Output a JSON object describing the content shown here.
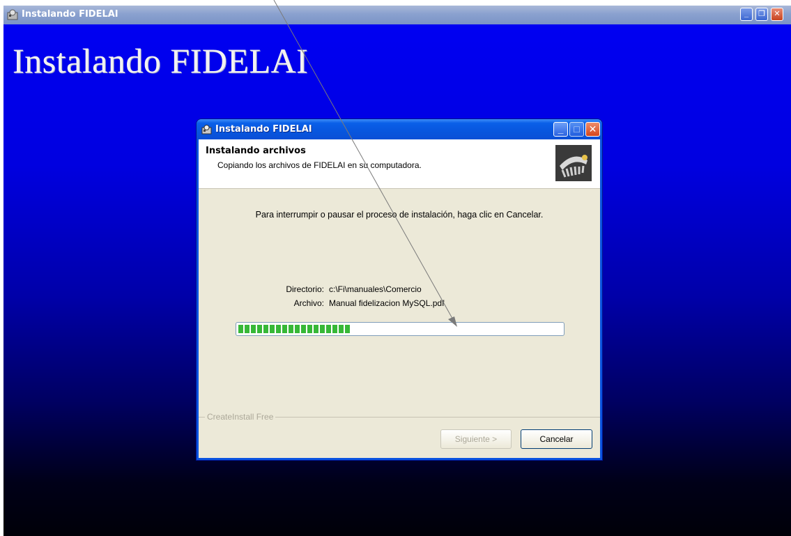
{
  "outer_window": {
    "title": "Instalando FIDELAI",
    "heading": "Instalando FIDELAI",
    "controls": [
      "minimize",
      "restore",
      "close"
    ]
  },
  "dialog": {
    "title": "Instalando FIDELAI",
    "header": {
      "title": "Instalando archivos",
      "subtitle": "Copiando los archivos de FIDELAI en su computadora."
    },
    "instruction": "Para interrumpir o pausar el proceso de instalación, haga clic en Cancelar.",
    "directory_label": "Directorio:",
    "directory_value": "c:\\Fi\\manuales\\Comercio",
    "file_label": "Archivo:",
    "file_value": "Manual fidelizacion MySQL.pdf",
    "progress_fraction": 0.35,
    "group_label": "CreateInstall Free",
    "buttons": {
      "next": "Siguiente >",
      "cancel": "Cancelar"
    }
  },
  "colors": {
    "background_top": "#0000f4",
    "progress_fill": "#37b837",
    "dialog_titlebar": "#0a56de"
  }
}
